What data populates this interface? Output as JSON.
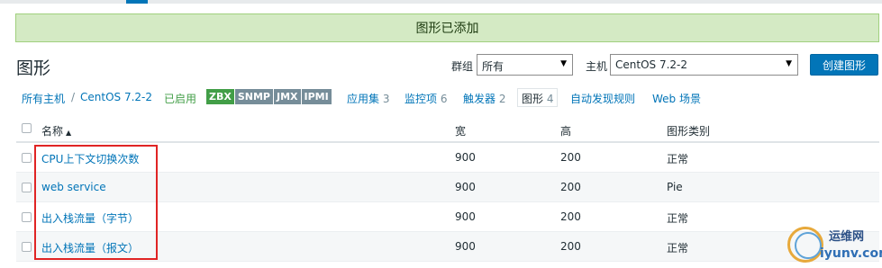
{
  "alert": {
    "message": "图形已添加"
  },
  "page": {
    "title": "图形"
  },
  "filters": {
    "group_label": "群组",
    "group_value": "所有",
    "host_label": "主机",
    "host_value": "CentOS 7.2-2",
    "create_button": "创建图形"
  },
  "nav": {
    "all_hosts": "所有主机",
    "separator": "/",
    "host": "CentOS 7.2-2",
    "status": "已启用",
    "tags": [
      "ZBX",
      "SNMP",
      "JMX",
      "IPMI"
    ],
    "applications": {
      "label": "应用集",
      "count": "3"
    },
    "items": {
      "label": "监控项",
      "count": "6"
    },
    "triggers": {
      "label": "触发器",
      "count": "2"
    },
    "graphs": {
      "label": "图形",
      "count": "4"
    },
    "discovery": {
      "label": "自动发现规则"
    },
    "web": {
      "label": "Web 场景"
    }
  },
  "table": {
    "headers": {
      "name": "名称",
      "sort_indicator": "▲",
      "width": "宽",
      "height": "高",
      "type": "图形类别"
    },
    "rows": [
      {
        "name": "CPU上下文切换次数",
        "width": "900",
        "height": "200",
        "type": "正常"
      },
      {
        "name": "web service",
        "width": "900",
        "height": "200",
        "type": "Pie"
      },
      {
        "name": "出入栈流量（字节）",
        "width": "900",
        "height": "200",
        "type": "正常"
      },
      {
        "name": "出入栈流量（报文）",
        "width": "900",
        "height": "200",
        "type": "正常"
      }
    ]
  },
  "watermark": {
    "title": "运维网",
    "url": "iyunv.com"
  },
  "colors": {
    "accent": "#0275b8",
    "success_bg": "#d4eac4",
    "enabled": "#429e47",
    "highlight": "#e02424"
  }
}
